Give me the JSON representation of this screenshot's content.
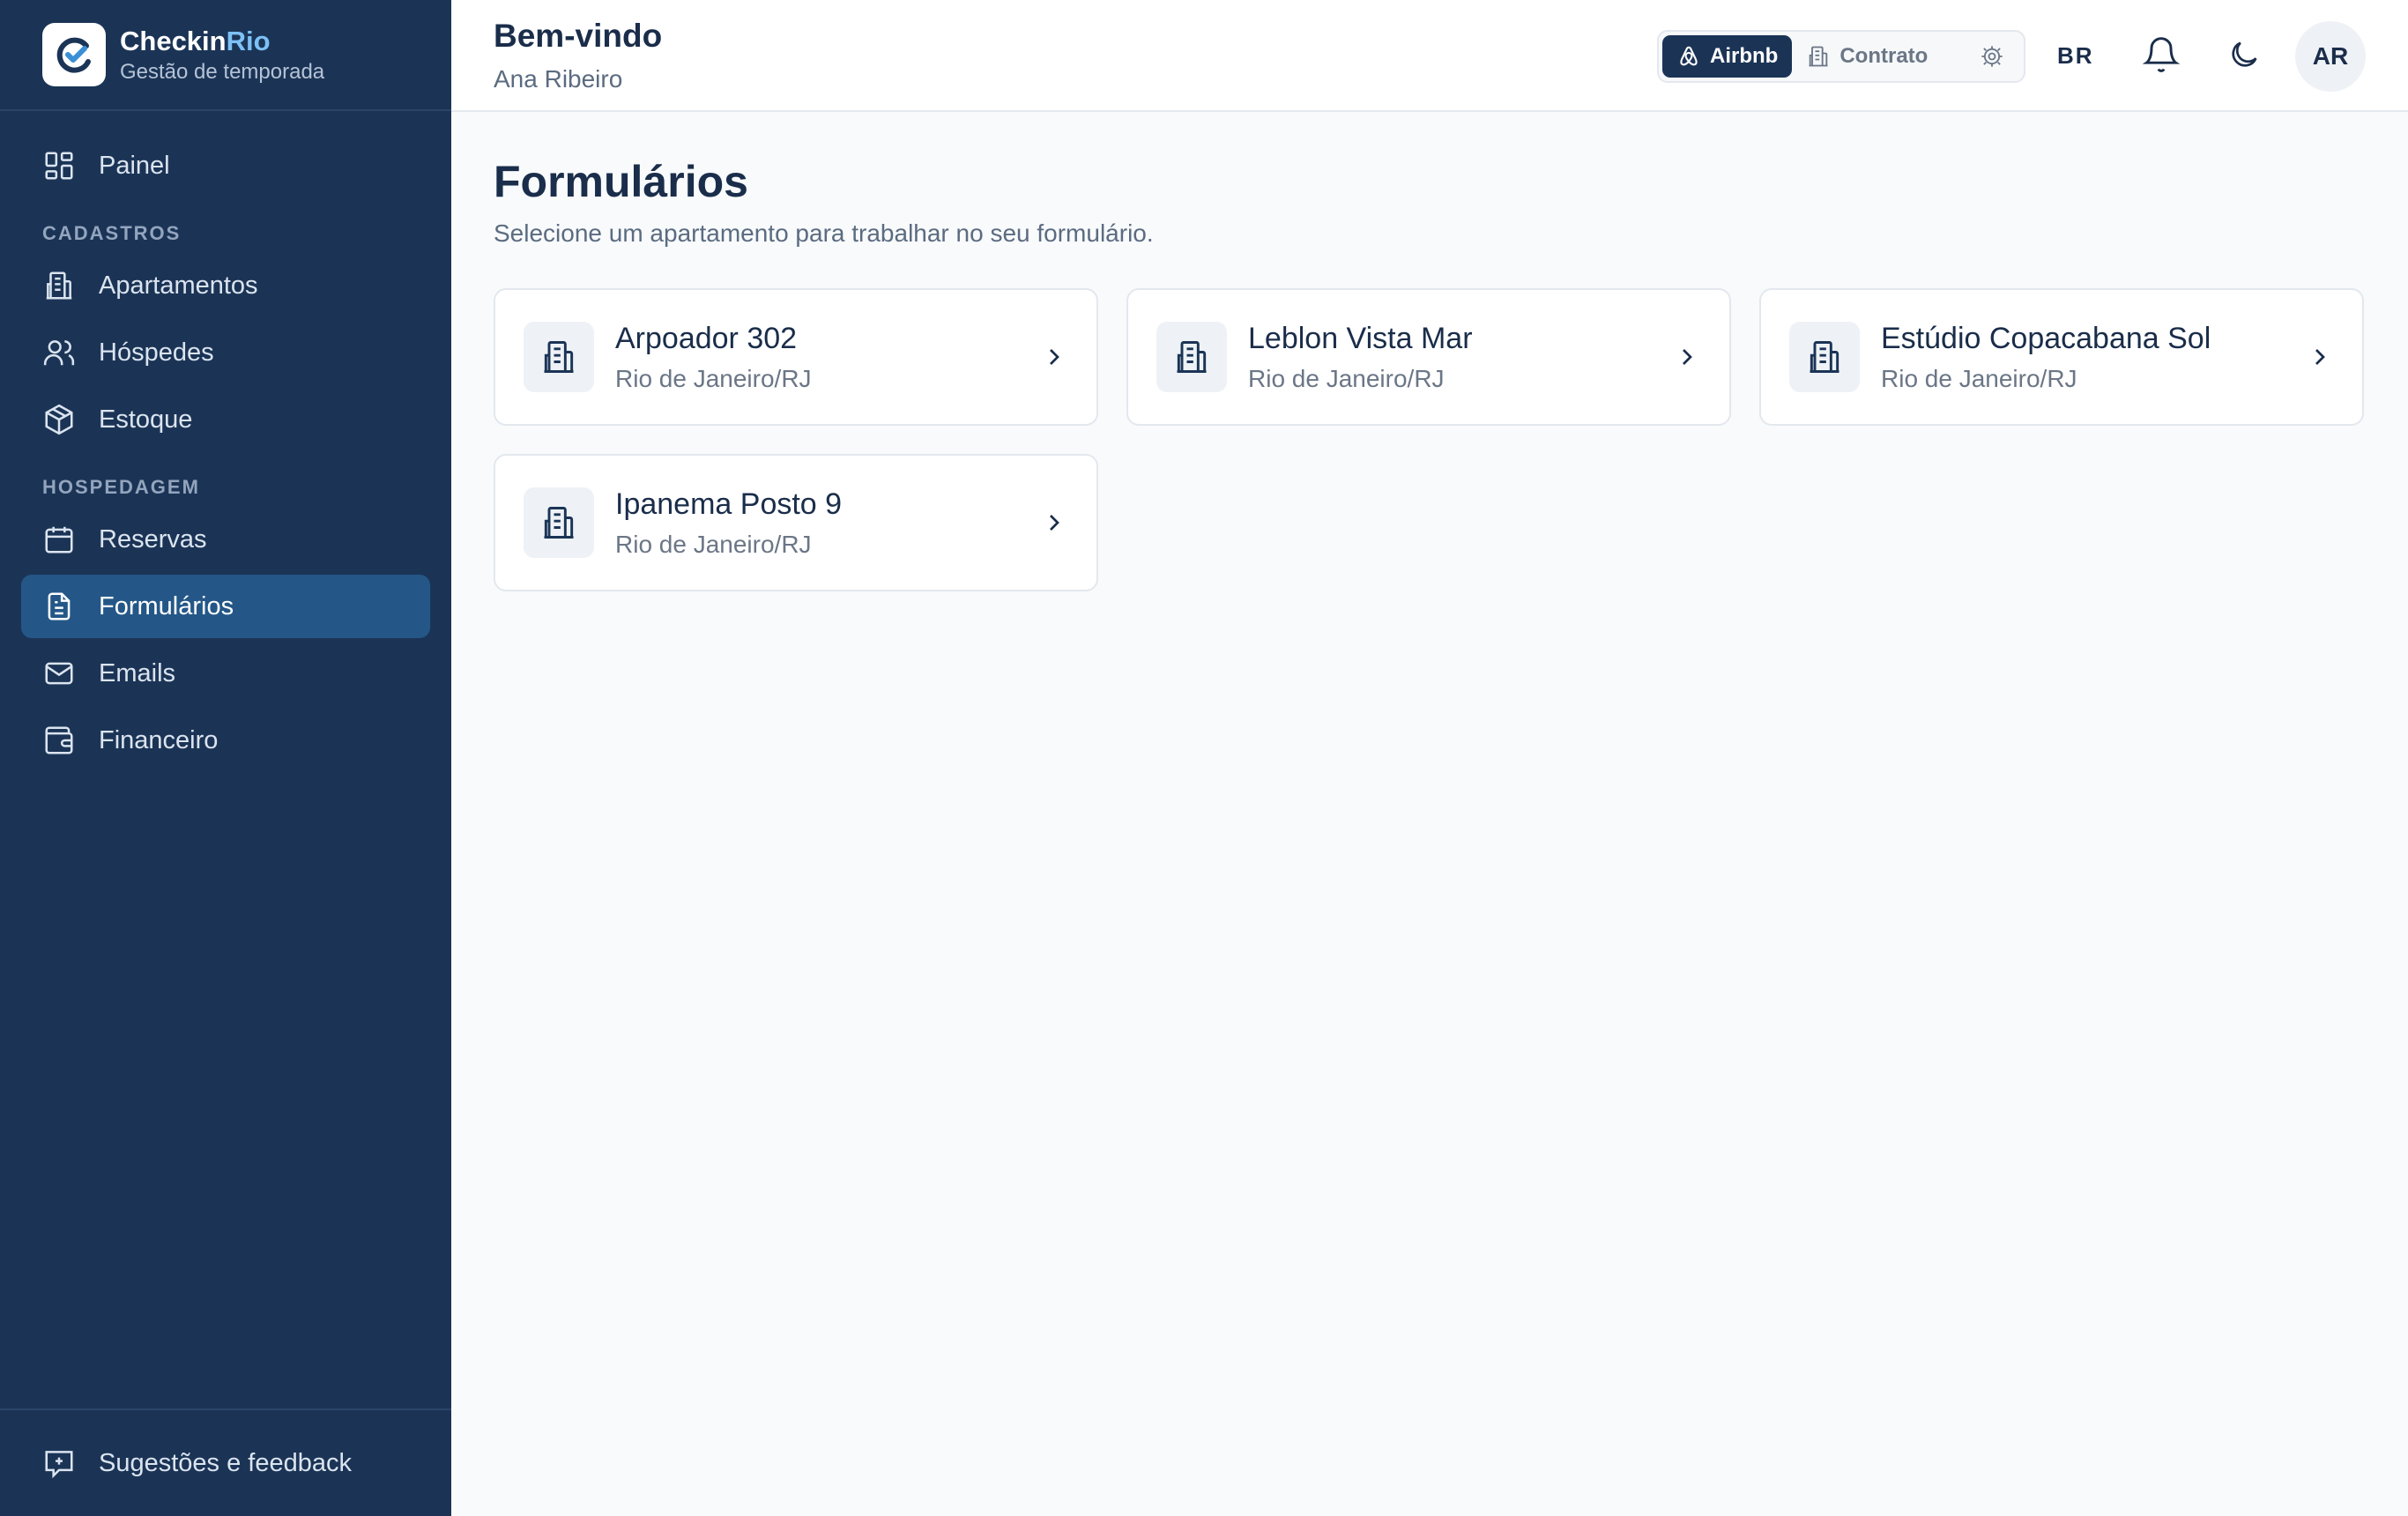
{
  "brand": {
    "name_main": "Checkin",
    "name_accent": "Rio",
    "tagline": "Gestão de temporada"
  },
  "sidebar": {
    "top_item": {
      "label": "Painel",
      "icon": "dashboard-icon"
    },
    "sections": [
      {
        "title": "CADASTROS",
        "items": [
          {
            "label": "Apartamentos",
            "icon": "building-icon"
          },
          {
            "label": "Hóspedes",
            "icon": "users-icon"
          },
          {
            "label": "Estoque",
            "icon": "package-icon"
          }
        ]
      },
      {
        "title": "HOSPEDAGEM",
        "items": [
          {
            "label": "Reservas",
            "icon": "calendar-icon"
          },
          {
            "label": "Formulários",
            "icon": "file-text-icon",
            "active": true
          },
          {
            "label": "Emails",
            "icon": "mail-icon"
          },
          {
            "label": "Financeiro",
            "icon": "wallet-icon"
          }
        ]
      }
    ],
    "footer_item": {
      "label": "Sugestões e feedback",
      "icon": "message-plus-icon"
    }
  },
  "header": {
    "title": "Bem-vindo",
    "user_name": "Ana Ribeiro",
    "mode_switch": {
      "active": "Airbnb",
      "inactive": "Contrato"
    },
    "language": "BR",
    "avatar_initials": "AR"
  },
  "main": {
    "title": "Formulários",
    "subtitle": "Selecione um apartamento para trabalhar no seu formulário.",
    "apartments": [
      {
        "name": "Arpoador 302",
        "city": "Rio de Janeiro/RJ"
      },
      {
        "name": "Leblon Vista Mar",
        "city": "Rio de Janeiro/RJ"
      },
      {
        "name": "Estúdio Copacabana Sol",
        "city": "Rio de Janeiro/RJ"
      },
      {
        "name": "Ipanema Posto 9",
        "city": "Rio de Janeiro/RJ"
      }
    ]
  },
  "colors": {
    "sidebar_bg": "#1b3456",
    "active_item_bg": "#245787",
    "brand_accent": "#7cc0f5",
    "page_bg": "#f8fafc"
  }
}
